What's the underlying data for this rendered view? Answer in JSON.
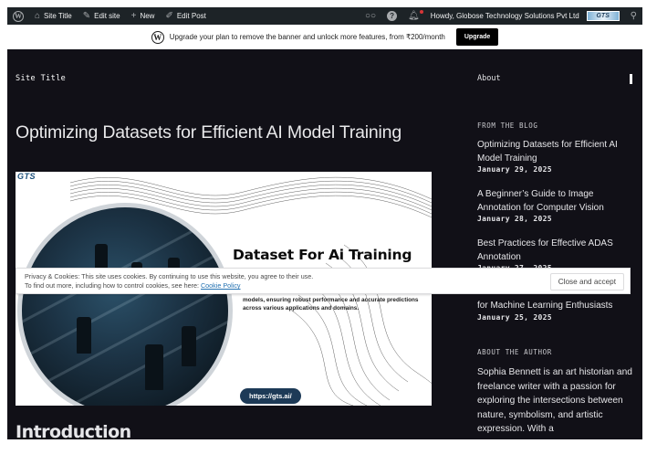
{
  "admin_bar": {
    "site_title": "Site Title",
    "edit_site": "Edit site",
    "new": "New",
    "edit_post": "Edit Post",
    "howdy": "Howdy, Globose Technology Solutions Pvt Ltd",
    "avatar_text": "GTS"
  },
  "banner": {
    "text": "Upgrade your plan to remove the banner and unlock more features, from ₹200/month",
    "button": "Upgrade"
  },
  "header": {
    "site_title": "Site Title",
    "about": "About"
  },
  "post": {
    "title": "Optimizing Datasets for Efficient AI Model Training",
    "featured": {
      "logo": "GTS",
      "heading": "Dataset For Ai Training",
      "body": "models, ensuring robust performance and accurate predictions across various applications and domains.",
      "url": "https://gts.ai/"
    },
    "first_heading": "Introduction"
  },
  "sidebar": {
    "blog_heading": "FROM THE BLOG",
    "posts": [
      {
        "title": "Optimizing Datasets for Efficient AI Model Training",
        "date": "January 29, 2025"
      },
      {
        "title": "A Beginner’s Guide to Image Annotation for Computer Vision",
        "date": "January 28, 2025"
      },
      {
        "title": "Best Practices for Effective ADAS Annotation",
        "date": "January 27, 2025"
      },
      {
        "title": "for Machine Learning Enthusiasts",
        "date": "January 25, 2025"
      }
    ],
    "author_heading": "ABOUT THE AUTHOR",
    "author_bio": "Sophia Bennett is an art historian and freelance writer with a passion for exploring the intersections between nature, symbolism, and artistic expression. With a"
  },
  "cookie": {
    "line1": "Privacy & Cookies: This site uses cookies. By continuing to use this website, you agree to their use.",
    "line2": "To find out more, including how to control cookies, see here:",
    "policy_link": "Cookie Policy",
    "button": "Close and accept"
  },
  "colors": {
    "admin_bar": "#1d2327",
    "site_background": "#111017",
    "link_blue": "#2271b1"
  }
}
